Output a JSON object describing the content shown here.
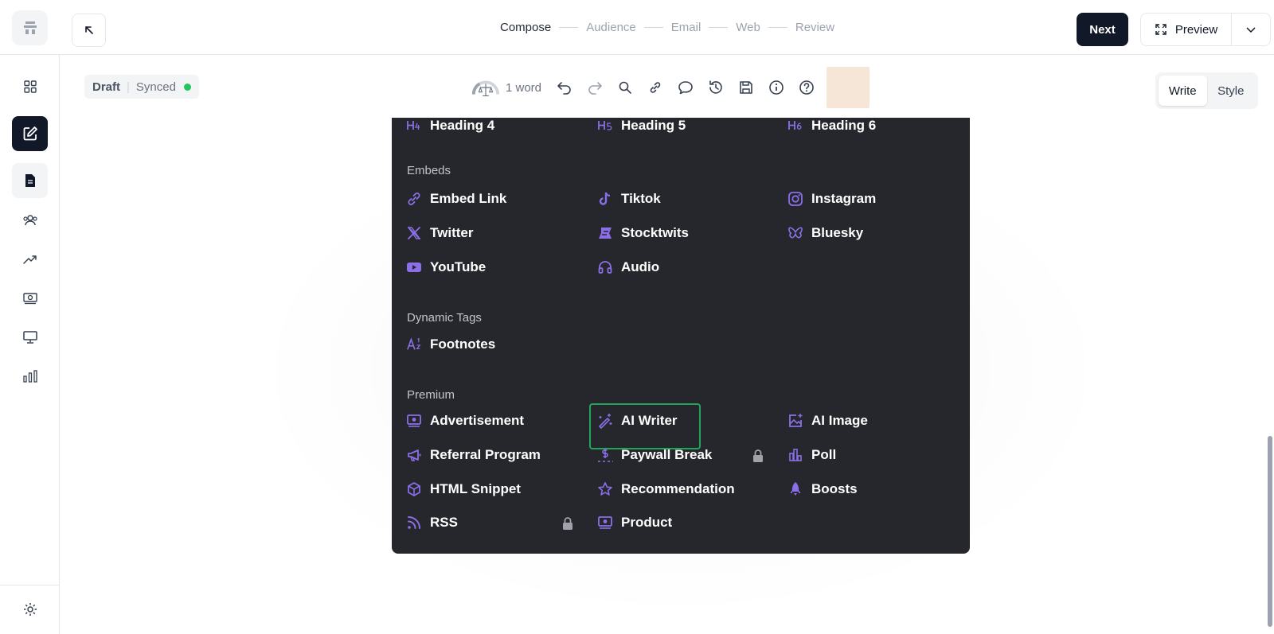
{
  "header": {
    "steps": [
      "Compose",
      "Audience",
      "Email",
      "Web",
      "Review"
    ],
    "active_step": "Compose",
    "next_label": "Next",
    "preview_label": "Preview"
  },
  "sidebar": {
    "items": [
      {
        "icon": "grid-icon"
      },
      {
        "icon": "edit-icon",
        "active": true
      },
      {
        "icon": "document-icon"
      },
      {
        "icon": "users-icon"
      },
      {
        "icon": "trending-icon"
      },
      {
        "icon": "money-icon"
      },
      {
        "icon": "monitor-icon"
      },
      {
        "icon": "bar-chart-icon"
      }
    ],
    "footer_icon": "settings-icon"
  },
  "editor": {
    "status": {
      "draft": "Draft",
      "synced": "Synced",
      "synced_color": "#22c55e"
    },
    "word_count": "1 word",
    "modes": [
      "Write",
      "Style"
    ],
    "active_mode": "Write"
  },
  "menu": {
    "headings": [
      "Heading 4",
      "Heading 5",
      "Heading 6"
    ],
    "embeds_title": "Embeds",
    "embeds": [
      "Embed Link",
      "Tiktok",
      "Instagram",
      "Twitter",
      "Stocktwits",
      "Bluesky",
      "YouTube",
      "Audio"
    ],
    "dynamic_title": "Dynamic Tags",
    "dynamic": [
      "Footnotes"
    ],
    "premium_title": "Premium",
    "premium": [
      "Advertisement",
      "AI Writer",
      "AI Image",
      "Referral Program",
      "Paywall Break",
      "Poll",
      "HTML Snippet",
      "Recommendation",
      "Boosts",
      "RSS",
      "Product"
    ],
    "highlighted": "AI Writer",
    "icon_color": "#8b6fe8",
    "highlight_color": "#22a559"
  }
}
